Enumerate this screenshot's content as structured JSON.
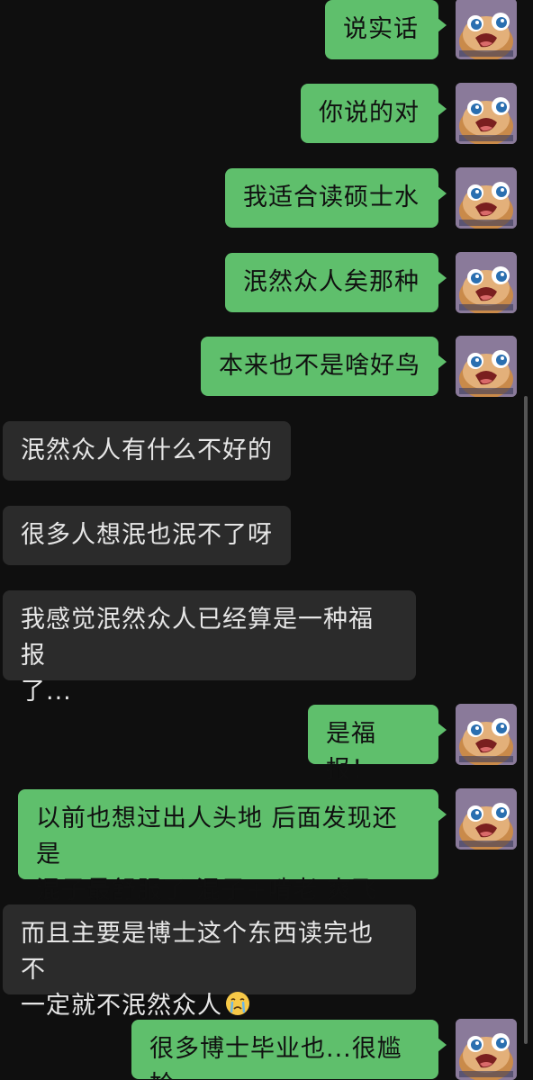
{
  "messages": [
    {
      "side": "sent",
      "text": "说实话"
    },
    {
      "side": "sent",
      "text": "你说的对"
    },
    {
      "side": "sent",
      "text": "我适合读硕士水"
    },
    {
      "side": "sent",
      "text": "泯然众人矣那种"
    },
    {
      "side": "sent",
      "text": "本来也不是啥好鸟"
    },
    {
      "side": "received",
      "text": "泯然众人有什么不好的"
    },
    {
      "side": "received",
      "text": "很多人想泯也泯不了呀"
    },
    {
      "side": "received",
      "text": "我感觉泯然众人已经算是一种福报\n了..."
    },
    {
      "side": "sent",
      "text": "是福报！"
    },
    {
      "side": "sent",
      "text": "以前也想过出人头地 后面发现还是\n混子最舒服了 混子+啃老 爽飞"
    },
    {
      "side": "received",
      "text": "而且主要是博士这个东西读完也不\n一定就不泯然众人",
      "emoji": "crying-face-emoji"
    },
    {
      "side": "sent",
      "text": "很多博士毕业也...很尴尬"
    }
  ],
  "avatar_icon": "cartoon-creature-avatar",
  "colors": {
    "background": "#0f0f0f",
    "sent_bubble": "#5fbf6c",
    "received_bubble": "#2b2b2b",
    "received_text": "#e6e6e6"
  }
}
